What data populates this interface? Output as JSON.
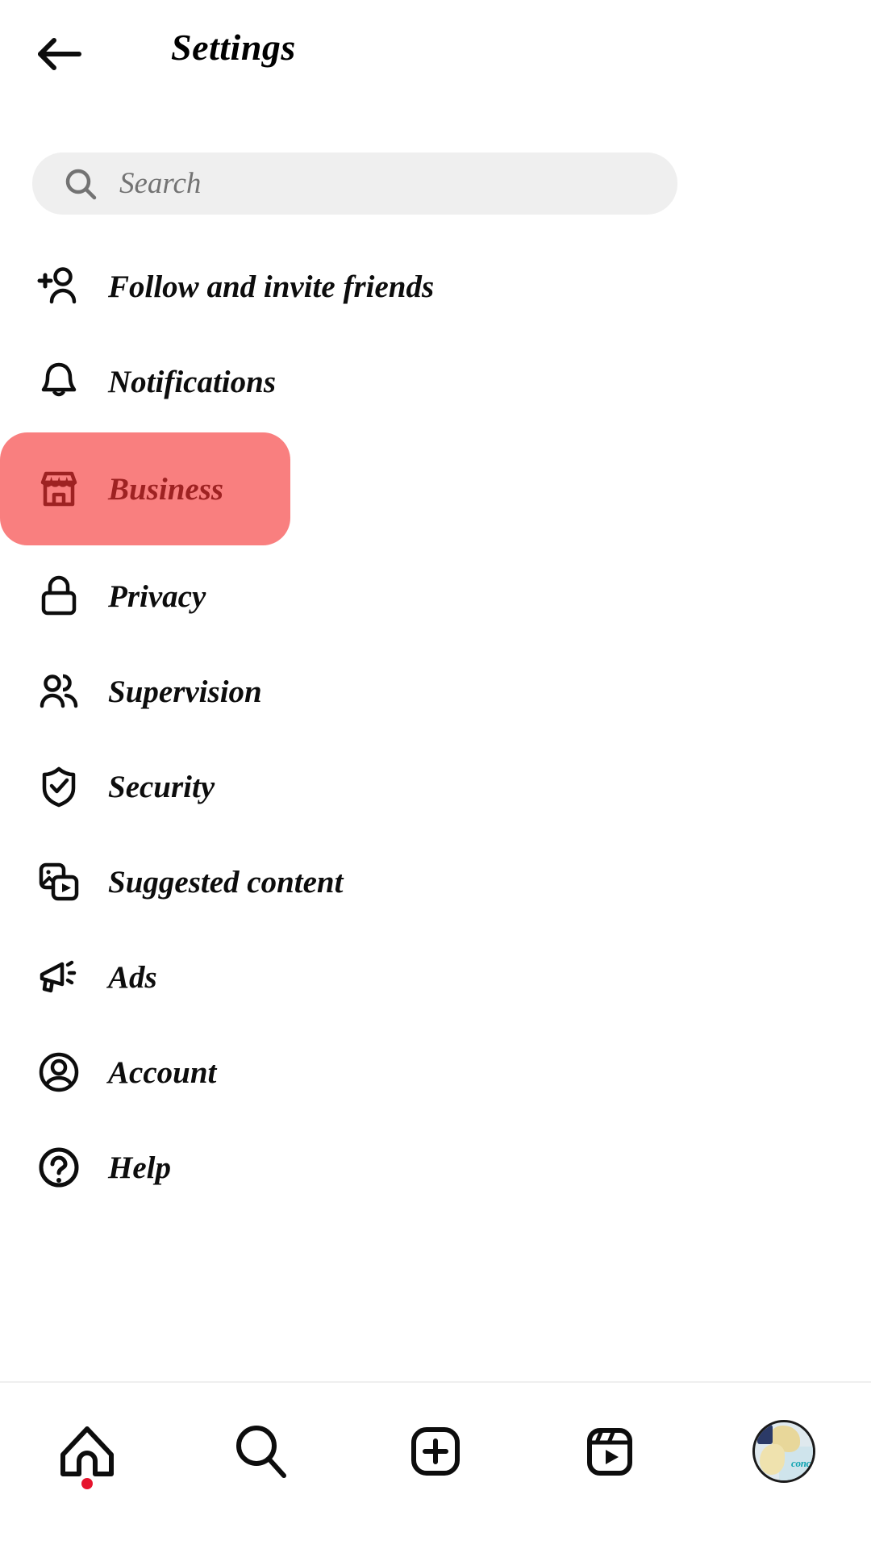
{
  "header": {
    "title": "Settings",
    "back_icon": "arrow-left-icon"
  },
  "search": {
    "placeholder": "Search",
    "value": "",
    "icon": "search-icon"
  },
  "menu": {
    "items": [
      {
        "label": "Follow and invite friends",
        "icon": "person-add-icon",
        "selected": false
      },
      {
        "label": "Notifications",
        "icon": "bell-icon",
        "selected": false
      },
      {
        "label": "Business",
        "icon": "storefront-icon",
        "selected": true
      },
      {
        "label": "Privacy",
        "icon": "lock-icon",
        "selected": false
      },
      {
        "label": "Supervision",
        "icon": "people-icon",
        "selected": false
      },
      {
        "label": "Security",
        "icon": "shield-check-icon",
        "selected": false
      },
      {
        "label": "Suggested content",
        "icon": "media-play-icon",
        "selected": false
      },
      {
        "label": "Ads",
        "icon": "megaphone-icon",
        "selected": false
      },
      {
        "label": "Account",
        "icon": "account-circle-icon",
        "selected": false
      },
      {
        "label": "Help",
        "icon": "help-circle-icon",
        "selected": false
      }
    ]
  },
  "bottom_nav": {
    "items": [
      {
        "name": "home",
        "icon": "home-icon",
        "badge": true
      },
      {
        "name": "search",
        "icon": "search-icon",
        "badge": false
      },
      {
        "name": "create",
        "icon": "plus-square-icon",
        "badge": false
      },
      {
        "name": "reels",
        "icon": "reels-icon",
        "badge": false
      },
      {
        "name": "profile",
        "icon": "avatar-icon",
        "badge": false
      }
    ],
    "avatar_text": "conc"
  },
  "colors": {
    "highlight_bg": "#F97F7F",
    "highlight_text": "#9E2222",
    "search_bg": "#EFEFEF",
    "badge": "#E6142D",
    "icon": "#1A1A1A"
  }
}
